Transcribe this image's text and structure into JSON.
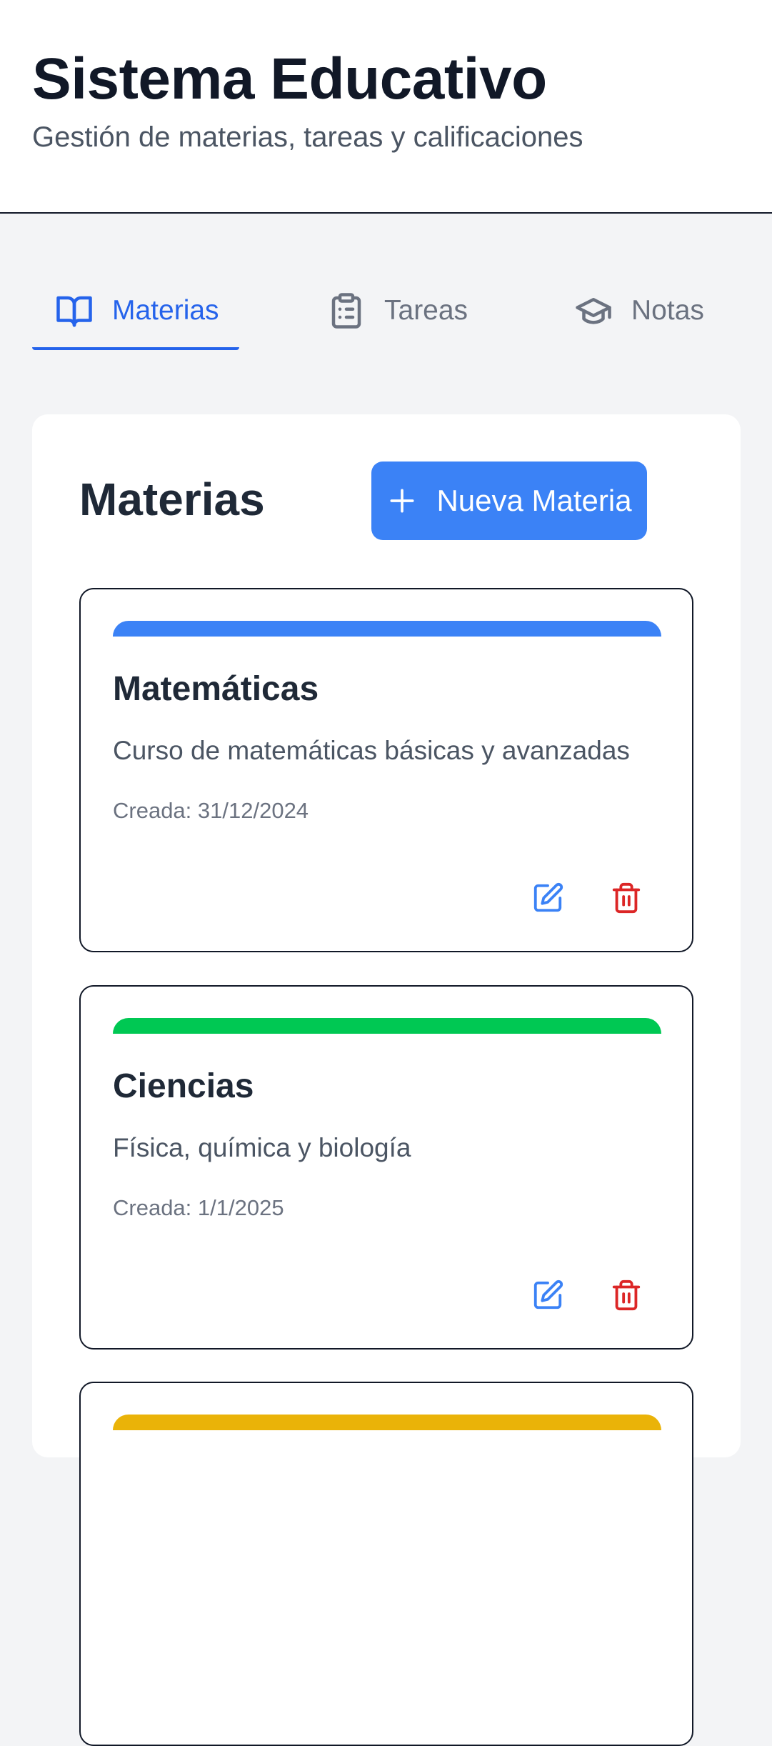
{
  "header": {
    "title": "Sistema Educativo",
    "subtitle": "Gestión de materias, tareas y calificaciones"
  },
  "tabs": [
    {
      "label": "Materias",
      "icon": "book-open-icon",
      "active": true
    },
    {
      "label": "Tareas",
      "icon": "clipboard-list-icon",
      "active": false
    },
    {
      "label": "Notas",
      "icon": "graduation-cap-icon",
      "active": false
    }
  ],
  "main": {
    "title": "Materias",
    "new_button_label": "Nueva Materia",
    "new_button_icon": "plus-icon"
  },
  "subjects": [
    {
      "name": "Matemáticas",
      "description": "Curso de matemáticas básicas y avanzadas",
      "created": "Creada: 31/12/2024",
      "color": "#3b82f6"
    },
    {
      "name": "Ciencias",
      "description": "Física, química y biología",
      "created": "Creada: 1/1/2025",
      "color": "#00c853"
    },
    {
      "name": "",
      "description": "",
      "created": "",
      "color": "#eab308"
    }
  ],
  "colors": {
    "accent": "#2563eb",
    "primary_button": "#3b82f6",
    "edit": "#3b82f6",
    "delete": "#dc2626"
  }
}
